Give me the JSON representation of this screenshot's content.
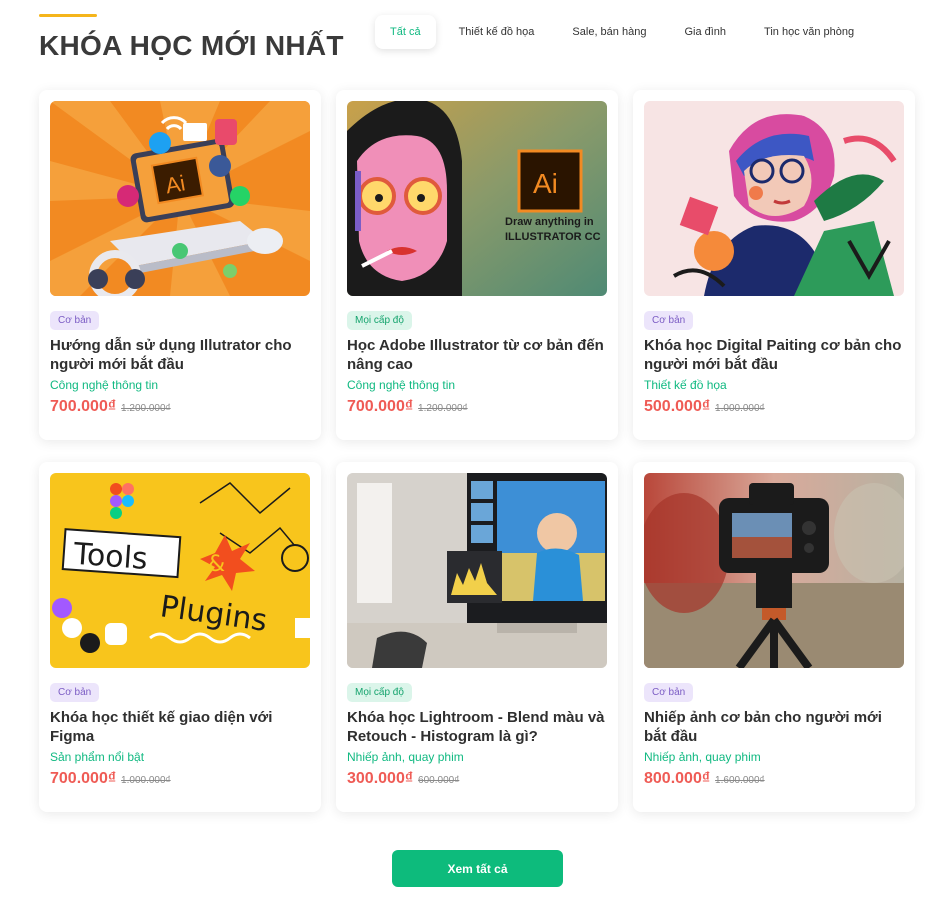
{
  "section": {
    "title": "KHÓA HỌC MỚI NHẤT"
  },
  "tabs": [
    {
      "label": "Tất cả",
      "active": true
    },
    {
      "label": "Thiết kế đồ họa"
    },
    {
      "label": "Sale, bán hàng"
    },
    {
      "label": "Gia đình"
    },
    {
      "label": "Tin học văn phòng"
    }
  ],
  "courses": [
    {
      "level": "Cơ bản",
      "title": "Hướng dẫn sử dụng Illutrator cho người mới bắt đầu",
      "category": "Công nghệ thông tin",
      "price": "700.000₫",
      "old_price": "1.200.000₫",
      "image": {
        "logo": "Ai"
      }
    },
    {
      "level": "Mọi cấp độ",
      "title": "Học Adobe Illustrator từ cơ bản đến nâng cao",
      "category": "Công nghệ thông tin",
      "price": "700.000₫",
      "old_price": "1.200.000₫",
      "image": {
        "logo": "Ai",
        "line1": "Draw anything in",
        "line2": "ILLUSTRATOR CC"
      }
    },
    {
      "level": "Cơ bản",
      "title": "Khóa học Digital Paiting cơ bản cho người mới bắt đầu",
      "category": "Thiết kế đồ họa",
      "price": "500.000₫",
      "old_price": "1.000.000₫",
      "image": {}
    },
    {
      "level": "Cơ bản",
      "title": "Khóa học thiết kế giao diện với Figma",
      "category": "Sản phẩm nổi bật",
      "price": "700.000₫",
      "old_price": "1.000.000₫",
      "image": {
        "word1": "Tools",
        "amp": "&",
        "word2": "Plugins"
      }
    },
    {
      "level": "Mọi cấp độ",
      "title": "Khóa học Lightroom - Blend màu và Retouch - Histogram là gì?",
      "category": "Nhiếp ảnh, quay phim",
      "price": "300.000₫",
      "old_price": "600.000₫",
      "image": {}
    },
    {
      "level": "Cơ bản",
      "title": "Nhiếp ảnh cơ bản cho người mới bắt đầu",
      "category": "Nhiếp ảnh, quay phim",
      "price": "800.000₫",
      "old_price": "1.600.000₫",
      "image": {}
    }
  ],
  "view_all": "Xem tất cả",
  "colors": {
    "accent": "#10b981",
    "price": "#ef5b55",
    "title_bar": "#f5b51b",
    "button": "#0dbb7c"
  }
}
